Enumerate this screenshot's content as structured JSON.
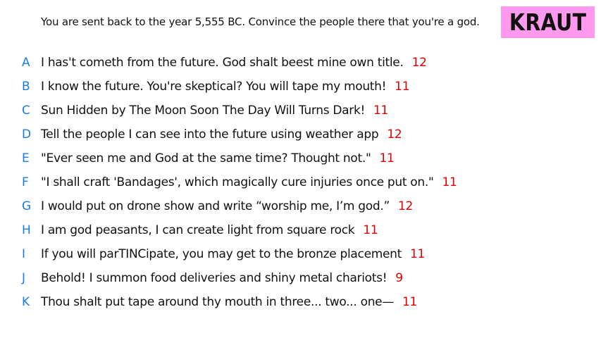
{
  "prompt": "You are sent back to the year 5,555 BC. Convince the people there that you're a god.",
  "badge": {
    "label": "KRAUT",
    "color": "#ff99ee"
  },
  "colors": {
    "letter": "#1a7fe0",
    "score": "#e00000",
    "text": "#111111"
  },
  "answers": [
    {
      "letter": "A",
      "text": "I has't cometh from the future. God shalt beest mine own title.",
      "score": "12"
    },
    {
      "letter": "B",
      "text": "I know the future. You're skeptical? You will tape my mouth!",
      "score": "11"
    },
    {
      "letter": "C",
      "text": "Sun Hidden by The Moon Soon The Day Will Turns Dark!",
      "score": "11"
    },
    {
      "letter": "D",
      "text": "Tell the people I can see into the future using weather app",
      "score": "12"
    },
    {
      "letter": "E",
      "text": "\"Ever seen me and God at the same time? Thought not.\"",
      "score": "11"
    },
    {
      "letter": "F",
      "text": "\"I shall craft 'Bandages', which magically cure injuries once put on.\"",
      "score": "11"
    },
    {
      "letter": "G",
      "text": "I would put on drone show and write “worship me, I’m god.”",
      "score": "12"
    },
    {
      "letter": "H",
      "text": "I am god peasants, I can create light from square rock",
      "score": "11"
    },
    {
      "letter": "I",
      "text": "If you will parTINCipate, you may get to the bronze placement",
      "score": "11"
    },
    {
      "letter": "J",
      "text": "Behold! I summon food deliveries and shiny metal chariots!",
      "score": "9"
    },
    {
      "letter": "K",
      "text": "Thou shalt put tape around thy mouth in three... two... one—",
      "score": "11"
    }
  ]
}
